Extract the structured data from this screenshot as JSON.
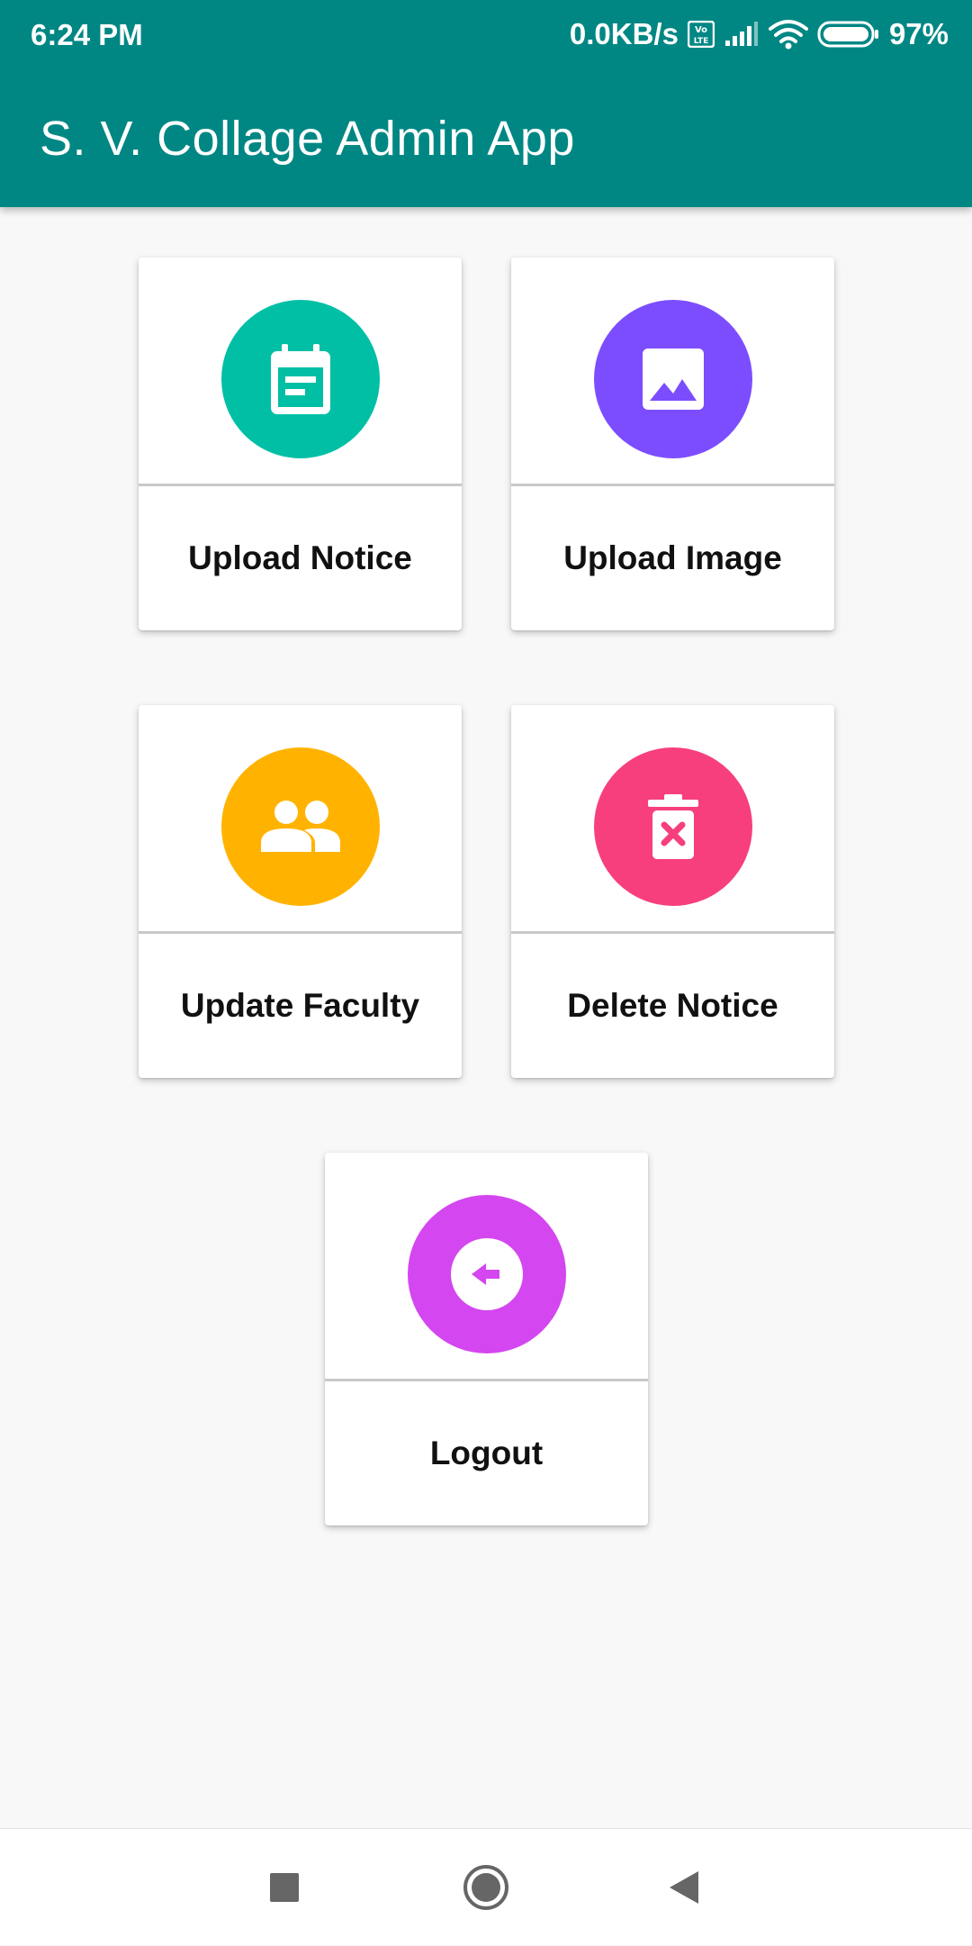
{
  "status_bar": {
    "time": "6:24 PM",
    "network_speed": "0.0KB/s",
    "battery": "97%",
    "icons": [
      "volte-icon",
      "signal-icon",
      "wifi-icon",
      "battery-icon"
    ]
  },
  "app_bar": {
    "title": "S. V. Collage Admin App",
    "color": "#008784"
  },
  "cards": [
    {
      "label": "Upload Notice",
      "icon": "notice-calendar-icon",
      "color": "#00bfa5"
    },
    {
      "label": "Upload Image",
      "icon": "image-icon",
      "color": "#7c4dff"
    },
    {
      "label": "Update Faculty",
      "icon": "people-icon",
      "color": "#ffb300"
    },
    {
      "label": "Delete Notice",
      "icon": "delete-icon",
      "color": "#f73f7d"
    },
    {
      "label": "Logout",
      "icon": "logout-icon",
      "color": "#d446ef"
    }
  ],
  "nav_bar": {
    "icons": [
      "recents-square-icon",
      "home-circle-icon",
      "back-triangle-icon"
    ]
  }
}
